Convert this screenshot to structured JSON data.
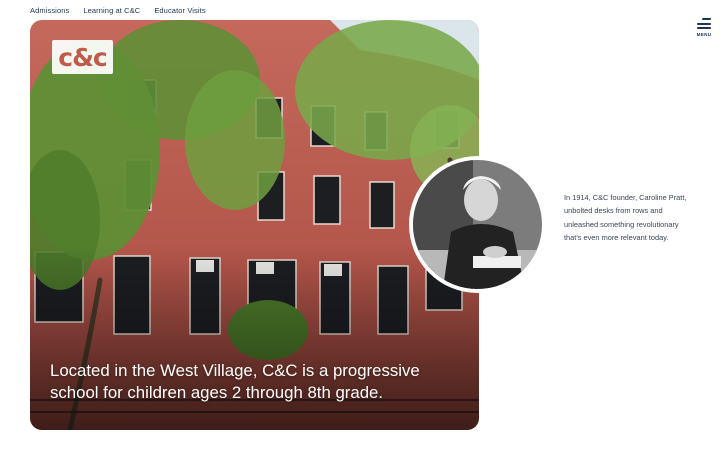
{
  "nav": {
    "links": [
      "Admissions",
      "Learning at C&C",
      "Educator Visits"
    ]
  },
  "menu": {
    "label": "MENU",
    "icon": "hamburger-icon"
  },
  "hero": {
    "logo_text": "c&c",
    "caption": "Located in the West Village, C&C is a progressive school for children ages 2 through 8th grade."
  },
  "feature": {
    "text": "In 1914, C&C founder, Caroline Pratt, unbolted desks from rows and unleashed something revolutionary that's even more relevant today."
  },
  "colors": {
    "brand_red": "#c7584d",
    "navy": "#1f3350",
    "brick": "#b95a4e",
    "foliage": "#5f8f36"
  }
}
